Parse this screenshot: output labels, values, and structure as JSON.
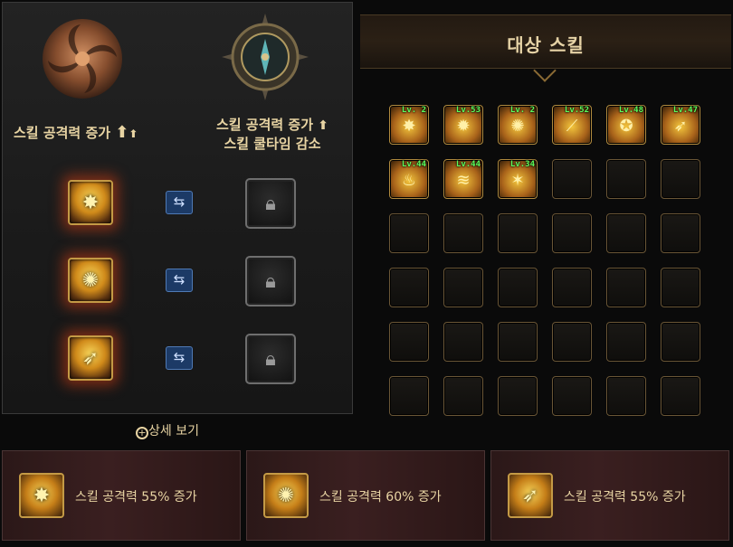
{
  "left_panel": {
    "category_1_title": "스킬 공격력 증가",
    "category_2_line1": "스킬 공격력 증가",
    "category_2_line2": "스킬 쿨타임 감소",
    "detail_link": "상세 보기"
  },
  "target_panel": {
    "title": "대상 스킬",
    "grid_rows": 6,
    "grid_cols": 6,
    "skills": [
      {
        "level": "Lv. 2",
        "icon": "explosion-skill-icon"
      },
      {
        "level": "Lv.53",
        "icon": "sun-burst-skill-icon"
      },
      {
        "level": "Lv. 2",
        "icon": "swirl-skill-icon"
      },
      {
        "level": "Lv.52",
        "icon": "claw-skill-icon"
      },
      {
        "level": "Lv.48",
        "icon": "ring-skill-icon"
      },
      {
        "level": "Lv.47",
        "icon": "bat-skill-icon"
      },
      {
        "level": "Lv.44",
        "icon": "flame-skill-icon"
      },
      {
        "level": "Lv.44",
        "icon": "dash-skill-icon"
      },
      {
        "level": "Lv.34",
        "icon": "stars-skill-icon"
      }
    ]
  },
  "bottom_cards": [
    {
      "text": "스킬 공격력 55% 증가",
      "icon": "explosion-skill-icon"
    },
    {
      "text": "스킬 공격력 60% 증가",
      "icon": "swirl-skill-icon"
    },
    {
      "text": "스킬 공격력 55% 증가",
      "icon": "bat-skill-icon"
    }
  ],
  "colors": {
    "accent_gold": "#c49a45",
    "level_green": "#5dff5d",
    "swap_blue": "#1c3a66"
  }
}
